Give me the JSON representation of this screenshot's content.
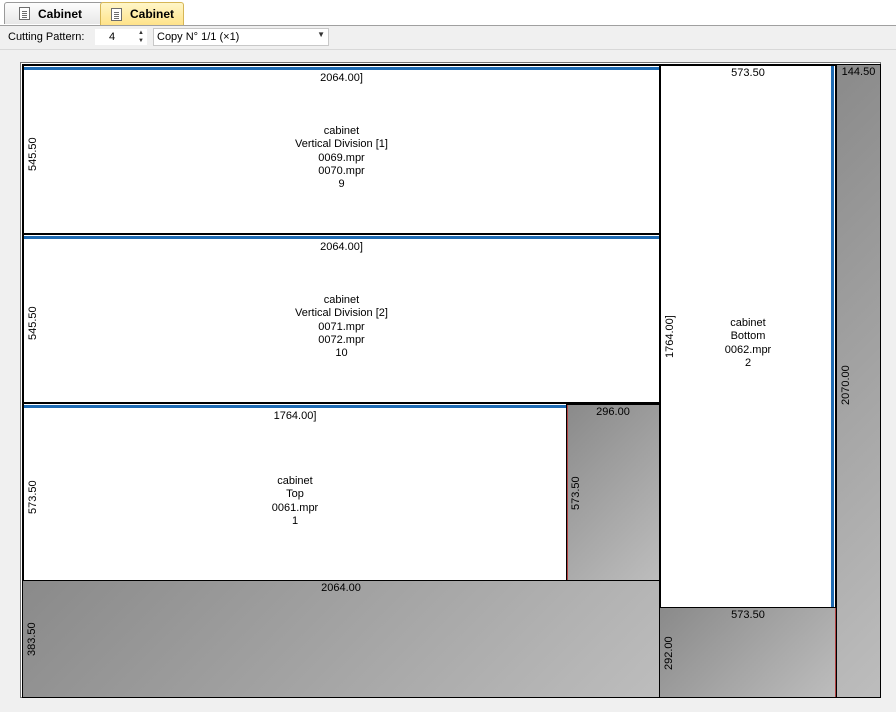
{
  "tabs": [
    {
      "label": "Cabinet",
      "state": "inactive"
    },
    {
      "label": "Cabinet",
      "state": "active"
    }
  ],
  "toolbar": {
    "cutting_pattern_label": "Cutting Pattern:",
    "cutting_pattern_value": "4",
    "copy_select_value": "Copy N° 1/1 (×1)"
  },
  "pieces": {
    "vd1": {
      "width": "2064.00]",
      "height": "545.50",
      "lines": [
        "cabinet",
        "Vertical Division [1]",
        "0069.mpr",
        "0070.mpr",
        "9"
      ]
    },
    "vd2": {
      "width": "2064.00]",
      "height": "545.50",
      "lines": [
        "cabinet",
        "Vertical Division [2]",
        "0071.mpr",
        "0072.mpr",
        "10"
      ]
    },
    "top": {
      "width": "1764.00]",
      "height": "573.50",
      "lines": [
        "cabinet",
        "Top",
        "0061.mpr",
        "1"
      ]
    },
    "bottom": {
      "width": "573.50",
      "height": "1764.00]",
      "lines": [
        "cabinet",
        "Bottom",
        "0062.mpr",
        "2"
      ]
    }
  },
  "waste": {
    "w1": {
      "width": "296.00",
      "height": "573.50"
    },
    "w2": {
      "width": "2064.00",
      "height": "383.50"
    },
    "w3": {
      "width": "573.50",
      "height": "292.00"
    },
    "w4": {
      "width": "144.50",
      "height": "2070.00"
    }
  },
  "colors": {
    "edge_band": "#1f6cb4",
    "waste_dark": "#8a8a8a",
    "waste_light": "#bdbdbd",
    "active_tab": "#ffe38a"
  }
}
